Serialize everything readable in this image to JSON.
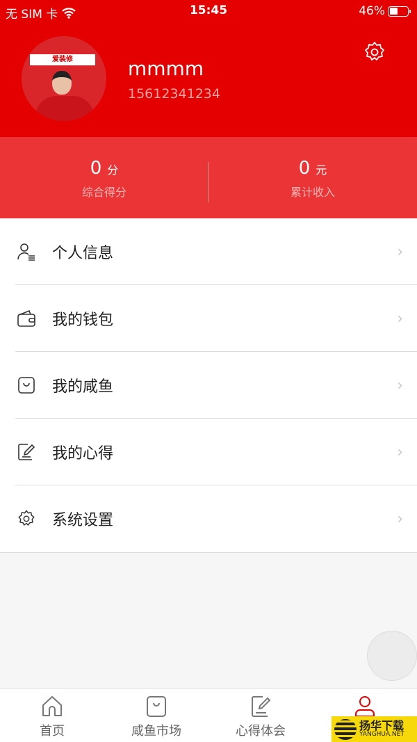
{
  "status_bar": {
    "carrier": "无 SIM 卡",
    "time": "15:45",
    "battery": "46%",
    "battery_level": 0.46
  },
  "profile": {
    "username": "mmmm",
    "phone": "15612341234",
    "avatar_sign": "爱装修"
  },
  "stats": [
    {
      "value": "0",
      "unit": "分",
      "label": "综合得分"
    },
    {
      "value": "0",
      "unit": "元",
      "label": "累计收入"
    }
  ],
  "menu": [
    {
      "icon": "user-list-icon",
      "label": "个人信息"
    },
    {
      "icon": "wallet-icon",
      "label": "我的钱包"
    },
    {
      "icon": "bag-icon",
      "label": "我的咸鱼"
    },
    {
      "icon": "edit-icon",
      "label": "我的心得"
    },
    {
      "icon": "gear-icon",
      "label": "系统设置"
    }
  ],
  "tabs": [
    {
      "icon": "home-icon",
      "label": "首页"
    },
    {
      "icon": "bag-icon",
      "label": "咸鱼市场"
    },
    {
      "icon": "edit-icon",
      "label": "心得体会"
    },
    {
      "icon": "user-icon",
      "label": ""
    }
  ],
  "colors": {
    "primary": "#e50000",
    "active_tab": "#e50000"
  },
  "watermark": {
    "title": "扬华下载",
    "subtitle": "YANGHUA.NET"
  }
}
